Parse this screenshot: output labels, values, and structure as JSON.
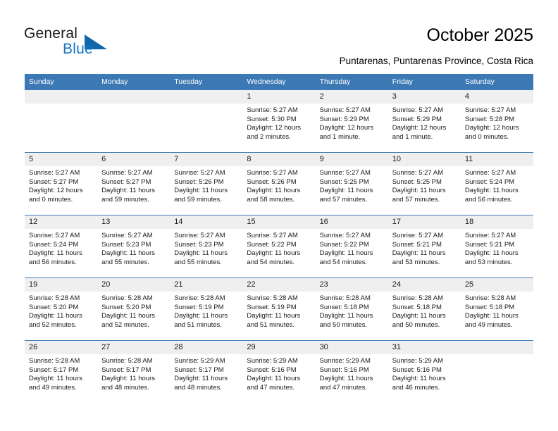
{
  "brand": {
    "name_top": "General",
    "name_bottom": "Blue",
    "accent_color": "#1167ab",
    "text_color": "#1275c4"
  },
  "header": {
    "title": "October 2025",
    "subtitle": "Puntarenas, Puntarenas Province, Costa Rica"
  },
  "calendar": {
    "header_bg": "#3b78b4",
    "daynum_bg": "#efefef",
    "weekdays": [
      "Sunday",
      "Monday",
      "Tuesday",
      "Wednesday",
      "Thursday",
      "Friday",
      "Saturday"
    ],
    "weeks": [
      [
        {
          "day": "",
          "lines": []
        },
        {
          "day": "",
          "lines": []
        },
        {
          "day": "",
          "lines": []
        },
        {
          "day": "1",
          "lines": [
            "Sunrise: 5:27 AM",
            "Sunset: 5:30 PM",
            "Daylight: 12 hours",
            "and 2 minutes."
          ]
        },
        {
          "day": "2",
          "lines": [
            "Sunrise: 5:27 AM",
            "Sunset: 5:29 PM",
            "Daylight: 12 hours",
            "and 1 minute."
          ]
        },
        {
          "day": "3",
          "lines": [
            "Sunrise: 5:27 AM",
            "Sunset: 5:29 PM",
            "Daylight: 12 hours",
            "and 1 minute."
          ]
        },
        {
          "day": "4",
          "lines": [
            "Sunrise: 5:27 AM",
            "Sunset: 5:28 PM",
            "Daylight: 12 hours",
            "and 0 minutes."
          ]
        }
      ],
      [
        {
          "day": "5",
          "lines": [
            "Sunrise: 5:27 AM",
            "Sunset: 5:27 PM",
            "Daylight: 12 hours",
            "and 0 minutes."
          ]
        },
        {
          "day": "6",
          "lines": [
            "Sunrise: 5:27 AM",
            "Sunset: 5:27 PM",
            "Daylight: 11 hours",
            "and 59 minutes."
          ]
        },
        {
          "day": "7",
          "lines": [
            "Sunrise: 5:27 AM",
            "Sunset: 5:26 PM",
            "Daylight: 11 hours",
            "and 59 minutes."
          ]
        },
        {
          "day": "8",
          "lines": [
            "Sunrise: 5:27 AM",
            "Sunset: 5:26 PM",
            "Daylight: 11 hours",
            "and 58 minutes."
          ]
        },
        {
          "day": "9",
          "lines": [
            "Sunrise: 5:27 AM",
            "Sunset: 5:25 PM",
            "Daylight: 11 hours",
            "and 57 minutes."
          ]
        },
        {
          "day": "10",
          "lines": [
            "Sunrise: 5:27 AM",
            "Sunset: 5:25 PM",
            "Daylight: 11 hours",
            "and 57 minutes."
          ]
        },
        {
          "day": "11",
          "lines": [
            "Sunrise: 5:27 AM",
            "Sunset: 5:24 PM",
            "Daylight: 11 hours",
            "and 56 minutes."
          ]
        }
      ],
      [
        {
          "day": "12",
          "lines": [
            "Sunrise: 5:27 AM",
            "Sunset: 5:24 PM",
            "Daylight: 11 hours",
            "and 56 minutes."
          ]
        },
        {
          "day": "13",
          "lines": [
            "Sunrise: 5:27 AM",
            "Sunset: 5:23 PM",
            "Daylight: 11 hours",
            "and 55 minutes."
          ]
        },
        {
          "day": "14",
          "lines": [
            "Sunrise: 5:27 AM",
            "Sunset: 5:23 PM",
            "Daylight: 11 hours",
            "and 55 minutes."
          ]
        },
        {
          "day": "15",
          "lines": [
            "Sunrise: 5:27 AM",
            "Sunset: 5:22 PM",
            "Daylight: 11 hours",
            "and 54 minutes."
          ]
        },
        {
          "day": "16",
          "lines": [
            "Sunrise: 5:27 AM",
            "Sunset: 5:22 PM",
            "Daylight: 11 hours",
            "and 54 minutes."
          ]
        },
        {
          "day": "17",
          "lines": [
            "Sunrise: 5:27 AM",
            "Sunset: 5:21 PM",
            "Daylight: 11 hours",
            "and 53 minutes."
          ]
        },
        {
          "day": "18",
          "lines": [
            "Sunrise: 5:27 AM",
            "Sunset: 5:21 PM",
            "Daylight: 11 hours",
            "and 53 minutes."
          ]
        }
      ],
      [
        {
          "day": "19",
          "lines": [
            "Sunrise: 5:28 AM",
            "Sunset: 5:20 PM",
            "Daylight: 11 hours",
            "and 52 minutes."
          ]
        },
        {
          "day": "20",
          "lines": [
            "Sunrise: 5:28 AM",
            "Sunset: 5:20 PM",
            "Daylight: 11 hours",
            "and 52 minutes."
          ]
        },
        {
          "day": "21",
          "lines": [
            "Sunrise: 5:28 AM",
            "Sunset: 5:19 PM",
            "Daylight: 11 hours",
            "and 51 minutes."
          ]
        },
        {
          "day": "22",
          "lines": [
            "Sunrise: 5:28 AM",
            "Sunset: 5:19 PM",
            "Daylight: 11 hours",
            "and 51 minutes."
          ]
        },
        {
          "day": "23",
          "lines": [
            "Sunrise: 5:28 AM",
            "Sunset: 5:18 PM",
            "Daylight: 11 hours",
            "and 50 minutes."
          ]
        },
        {
          "day": "24",
          "lines": [
            "Sunrise: 5:28 AM",
            "Sunset: 5:18 PM",
            "Daylight: 11 hours",
            "and 50 minutes."
          ]
        },
        {
          "day": "25",
          "lines": [
            "Sunrise: 5:28 AM",
            "Sunset: 5:18 PM",
            "Daylight: 11 hours",
            "and 49 minutes."
          ]
        }
      ],
      [
        {
          "day": "26",
          "lines": [
            "Sunrise: 5:28 AM",
            "Sunset: 5:17 PM",
            "Daylight: 11 hours",
            "and 49 minutes."
          ]
        },
        {
          "day": "27",
          "lines": [
            "Sunrise: 5:28 AM",
            "Sunset: 5:17 PM",
            "Daylight: 11 hours",
            "and 48 minutes."
          ]
        },
        {
          "day": "28",
          "lines": [
            "Sunrise: 5:29 AM",
            "Sunset: 5:17 PM",
            "Daylight: 11 hours",
            "and 48 minutes."
          ]
        },
        {
          "day": "29",
          "lines": [
            "Sunrise: 5:29 AM",
            "Sunset: 5:16 PM",
            "Daylight: 11 hours",
            "and 47 minutes."
          ]
        },
        {
          "day": "30",
          "lines": [
            "Sunrise: 5:29 AM",
            "Sunset: 5:16 PM",
            "Daylight: 11 hours",
            "and 47 minutes."
          ]
        },
        {
          "day": "31",
          "lines": [
            "Sunrise: 5:29 AM",
            "Sunset: 5:16 PM",
            "Daylight: 11 hours",
            "and 46 minutes."
          ]
        },
        {
          "day": "",
          "lines": []
        }
      ]
    ]
  }
}
